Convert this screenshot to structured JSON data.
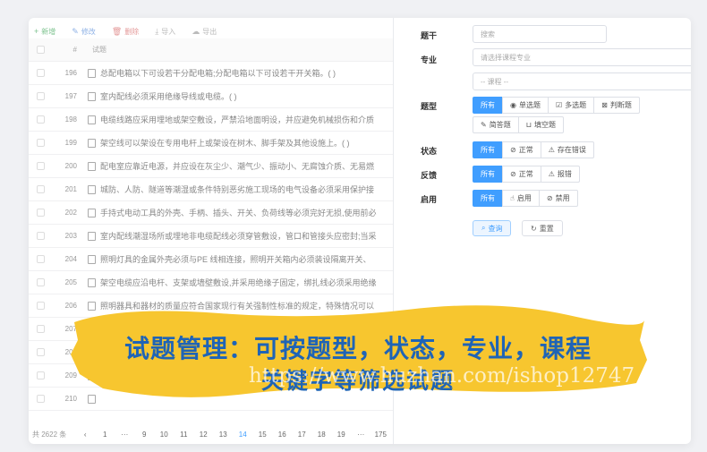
{
  "toolbar": {
    "add": "新增",
    "edit": "修改",
    "delete": "删除",
    "import": "导入",
    "export": "导出"
  },
  "table": {
    "col_hash": "#",
    "col_title": "试题",
    "rows": [
      {
        "id": "196",
        "text": "总配电箱以下可设若干分配电箱;分配电箱以下可设若干开关箱。( )"
      },
      {
        "id": "197",
        "text": "室内配线必须采用绝缘导线或电缆。( )"
      },
      {
        "id": "198",
        "text": "电缆线路应采用埋地或架空敷设，严禁沿地面明设，并应避免机械损伤和介质"
      },
      {
        "id": "199",
        "text": "架空线可以架设在专用电杆上或架设在树木、脚手架及其他设施上。( )"
      },
      {
        "id": "200",
        "text": "配电室应靠近电源，并应设在灰尘少、潮气少、振动小、无腐蚀介质、无易燃"
      },
      {
        "id": "201",
        "text": "城防、人防、隧道等潮湿或条件特别恶劣施工现场的电气设备必须采用保护接"
      },
      {
        "id": "202",
        "text": "手持式电动工具的外壳、手柄、插头、开关、负荷线等必须完好无损,使用前必"
      },
      {
        "id": "203",
        "text": "室内配线潮湿场所或埋地非电缆配线必须穿管敷设，管口和管接头应密封;当采"
      },
      {
        "id": "204",
        "text": "照明灯具的金属外壳必须与PE 线相连接，照明开关箱内必须装设隔离开关、"
      },
      {
        "id": "205",
        "text": "架空电缆应沿电杆、支架或墙壁敷设,并采用绝缘子固定，绑扎线必须采用绝缘"
      },
      {
        "id": "206",
        "text": "照明器具和器材的质量应符合国家现行有关强制性标准的规定，特殊情况可以"
      },
      {
        "id": "207",
        "text": ""
      },
      {
        "id": "208",
        "text": ""
      },
      {
        "id": "209",
        "text": ""
      },
      {
        "id": "210",
        "text": ""
      }
    ]
  },
  "pager": {
    "total": "共 2622 条",
    "prev": "‹",
    "pages": [
      "1",
      "···",
      "9",
      "10",
      "11",
      "12",
      "13",
      "14",
      "15",
      "16",
      "17",
      "18",
      "19",
      "···",
      "175"
    ],
    "active": "14"
  },
  "filter": {
    "title_label": "题干",
    "title_placeholder": "搜索",
    "major_label": "专业",
    "major_placeholder": "请选择课程专业",
    "course_placeholder": "-- 课程 --",
    "type_label": "题型",
    "types": [
      "所有",
      "单选题",
      "多选题",
      "判断题",
      "简答题",
      "填空题"
    ],
    "status_label": "状态",
    "statuses": [
      "所有",
      "正常",
      "存在错误"
    ],
    "feedback_label": "反馈",
    "feedbacks": [
      "所有",
      "正常",
      "报错"
    ],
    "enable_label": "启用",
    "enables": [
      "所有",
      "启用",
      "禁用"
    ],
    "query": "查询",
    "reset": "重置"
  },
  "banner": {
    "line1": "试题管理：可按题型，状态，专业，课程",
    "line2": "关键字等筛选试题",
    "watermark": "https://www.huzhan.com/ishop12747",
    "color": "#f7c62f"
  }
}
